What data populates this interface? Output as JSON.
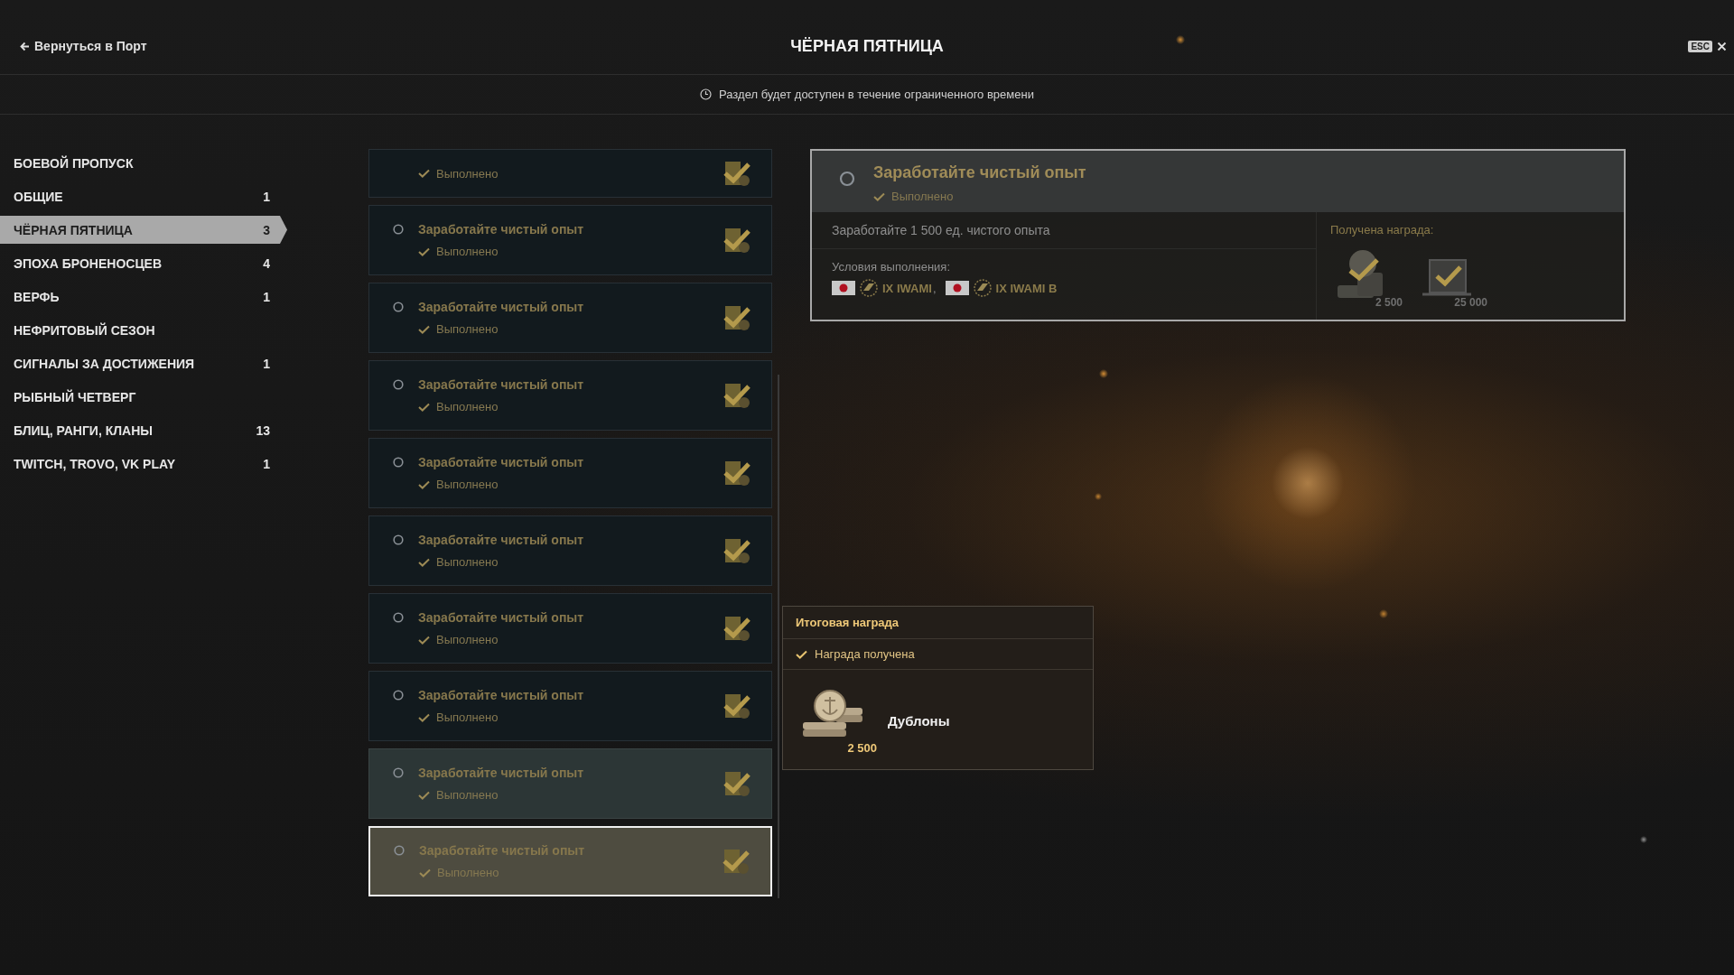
{
  "header": {
    "back_link": "Вернуться в Порт",
    "title": "ЧЁРНАЯ ПЯТНИЦА",
    "esc_key": "ESC"
  },
  "notice": "Раздел будет доступен в течение ограниченного времени",
  "sidebar": {
    "items": [
      {
        "label": "БОЕВОЙ ПРОПУСК",
        "selected": false
      },
      {
        "label": "ОБЩИЕ",
        "count": "1",
        "selected": false
      },
      {
        "label": "ЧЁРНАЯ ПЯТНИЦА",
        "count": "3",
        "selected": true
      },
      {
        "label": "ЭПОХА БРОНЕНОСЦЕВ",
        "count": "4",
        "selected": false
      },
      {
        "label": "ВЕРФЬ",
        "count": "1",
        "selected": false
      },
      {
        "label": "НЕФРИТОВЫЙ СЕЗОН",
        "selected": false
      },
      {
        "label": "СИГНАЛЫ ЗА ДОСТИЖЕНИЯ",
        "count": "1",
        "selected": false
      },
      {
        "label": "РЫБНЫЙ ЧЕТВЕРГ",
        "selected": false
      },
      {
        "label": "БЛИЦ, РАНГИ, КЛАНЫ",
        "count": "13",
        "selected": false
      },
      {
        "label": "TWITCH, TROVO, VK PLAY",
        "count": "1",
        "selected": false
      }
    ]
  },
  "tasks": [
    {
      "status": "Выполнено",
      "selected": false,
      "hovered": false
    },
    {
      "title": "Заработайте чистый опыт",
      "status": "Выполнено",
      "selected": false,
      "hovered": false
    },
    {
      "title": "Заработайте чистый опыт",
      "status": "Выполнено",
      "selected": false,
      "hovered": false
    },
    {
      "title": "Заработайте чистый опыт",
      "status": "Выполнено",
      "selected": false,
      "hovered": false
    },
    {
      "title": "Заработайте чистый опыт",
      "status": "Выполнено",
      "selected": false,
      "hovered": false
    },
    {
      "title": "Заработайте чистый опыт",
      "status": "Выполнено",
      "selected": false,
      "hovered": false
    },
    {
      "title": "Заработайте чистый опыт",
      "status": "Выполнено",
      "selected": false,
      "hovered": false
    },
    {
      "title": "Заработайте чистый опыт",
      "status": "Выполнено",
      "selected": false,
      "hovered": false
    },
    {
      "title": "Заработайте чистый опыт",
      "status": "Выполнено",
      "selected": false,
      "hovered": true
    },
    {
      "title": "Заработайте чистый опыт",
      "status": "Выполнено",
      "selected": true,
      "hovered": false
    }
  ],
  "detail": {
    "title": "Заработайте чистый опыт",
    "status": "Выполнено",
    "description": "Заработайте 1 500 ед. чистого опыта",
    "conditions_label": "Условия выполнения:",
    "conditions": [
      {
        "ship": "IX IWAMI",
        "suffix": ","
      },
      {
        "ship": "IX IWAMI B"
      }
    ],
    "rewards_label": "Получена награда:",
    "rewards": [
      {
        "kind": "coins",
        "amount": "2 500"
      },
      {
        "kind": "chest",
        "amount": "25 000"
      }
    ]
  },
  "tooltip": {
    "title": "Итоговая награда",
    "status": "Награда получена",
    "reward_name": "Дублоны",
    "amount": "2 500"
  }
}
